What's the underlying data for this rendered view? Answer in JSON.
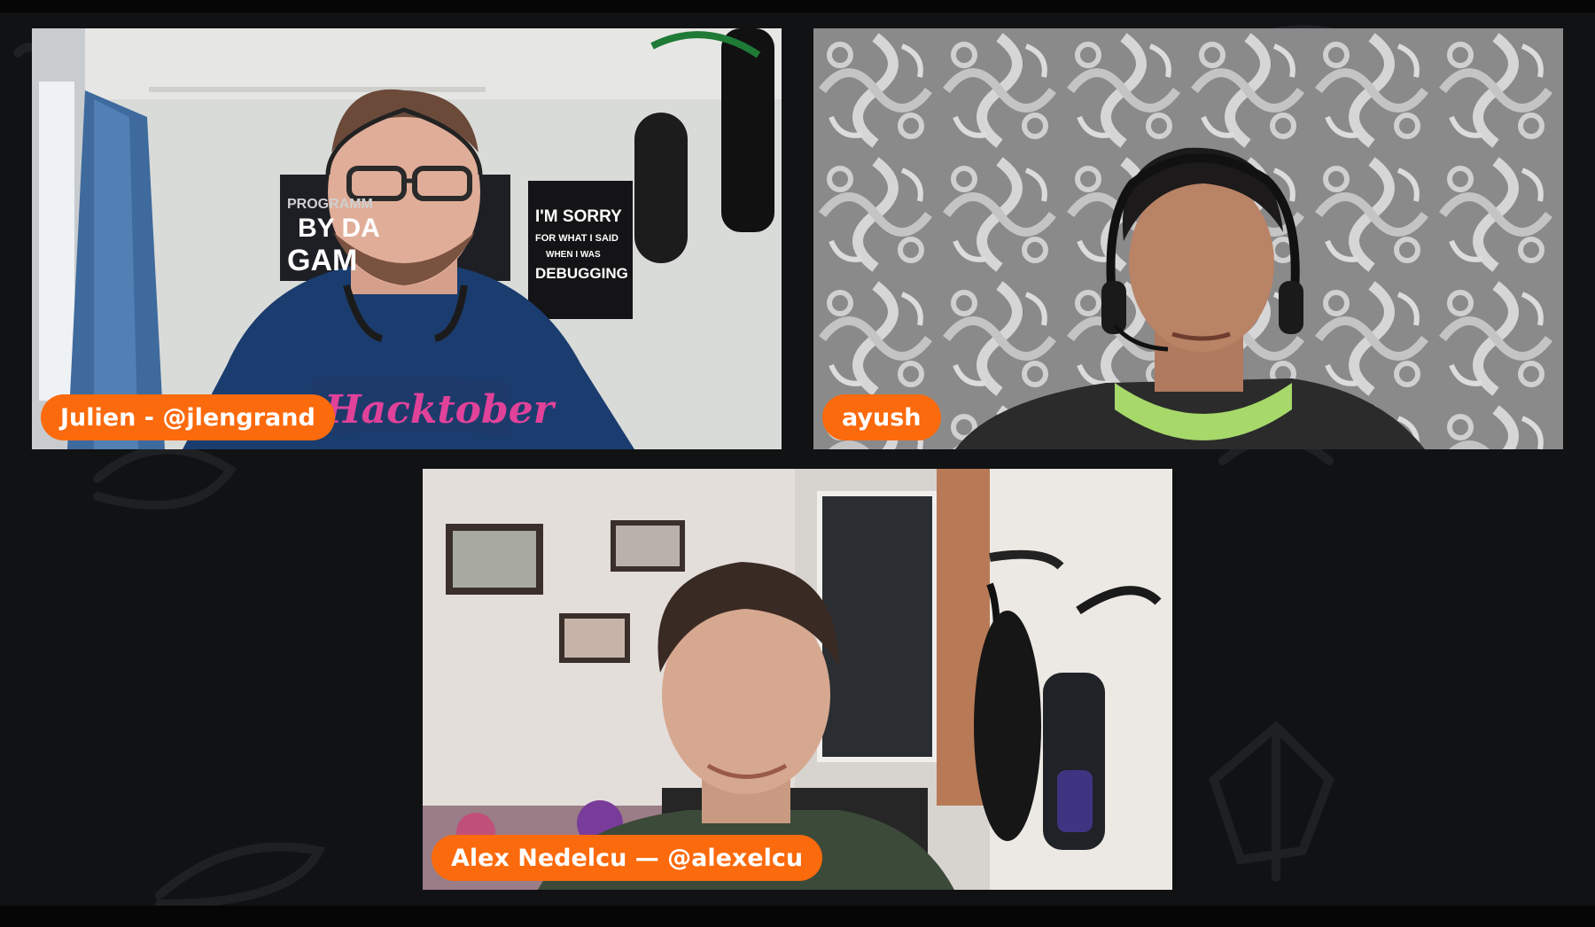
{
  "call": {
    "participants": [
      {
        "id": "julien",
        "display_name": "Julien - @jlengrand"
      },
      {
        "id": "ayush",
        "display_name": "ayush"
      },
      {
        "id": "alex",
        "display_name": "Alex Nedelcu — @alexelcu"
      }
    ],
    "poster": {
      "left_lines": [
        "PROGRAMM",
        "BY DA",
        "GAM"
      ],
      "right_lines": [
        "I'M SORRY",
        "FOR WHAT I SAID",
        "WHEN I WAS",
        "DEBUGGING"
      ]
    },
    "shirt_text": "Hacktober"
  },
  "colors": {
    "accent": "#fb6a0c",
    "background": "#111214"
  }
}
